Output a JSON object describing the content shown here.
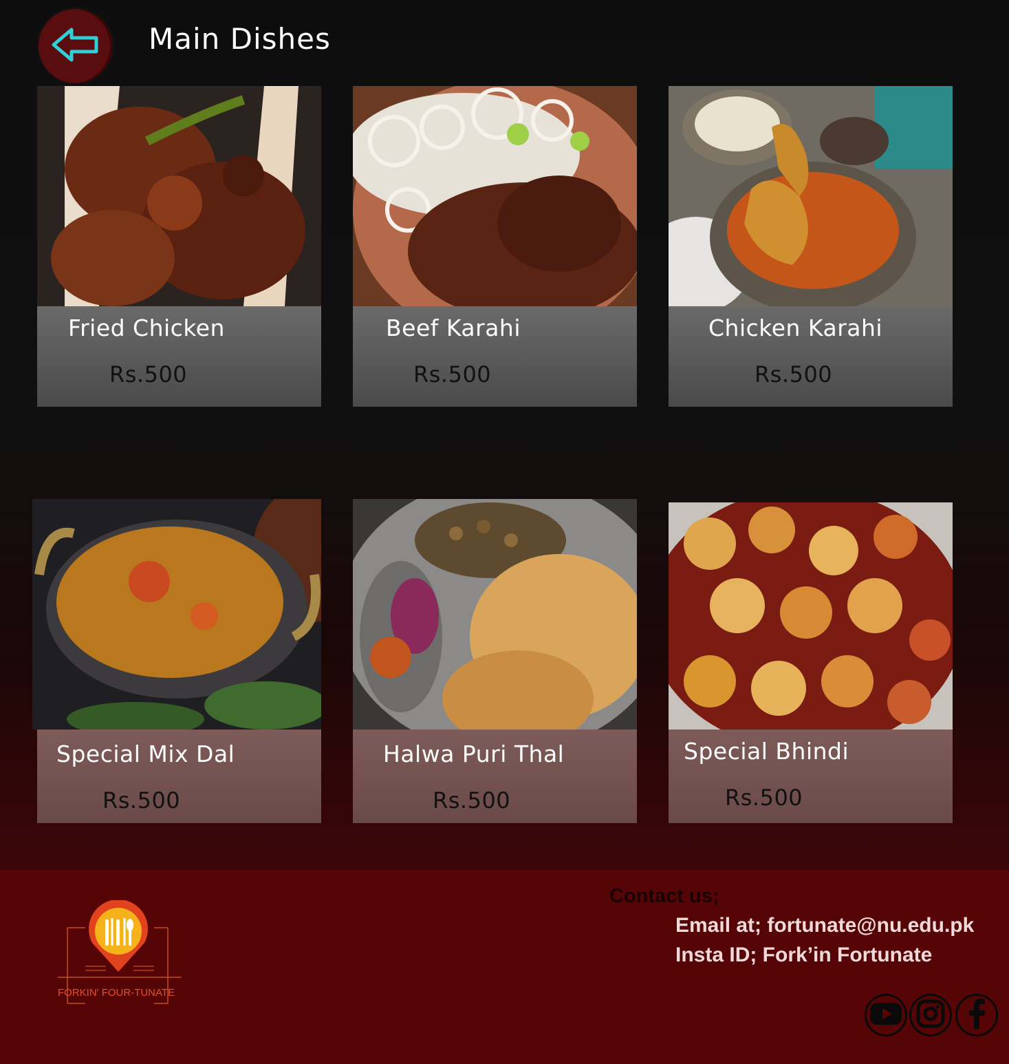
{
  "header": {
    "title": "Main Dishes"
  },
  "dishes": [
    {
      "name": "Fried Chicken",
      "price": "Rs.500"
    },
    {
      "name": "Beef Karahi",
      "price": "Rs.500"
    },
    {
      "name": "Chicken Karahi",
      "price": "Rs.500"
    },
    {
      "name": "Special Mix Dal",
      "price": "Rs.500"
    },
    {
      "name": "Halwa Puri Thal",
      "price": "Rs.500"
    },
    {
      "name": "Special Bhindi",
      "price": "Rs.500"
    }
  ],
  "footer": {
    "contact_heading": "Contact us;",
    "email_line": "Email at; fortunate@nu.edu.pk",
    "insta_line": "Insta ID; Fork’in Fortunate",
    "logo_text": "FORKIN' FOUR-TUNATE"
  },
  "icons": {
    "back": "back-arrow-icon",
    "youtube": "youtube-icon",
    "instagram": "instagram-icon",
    "facebook": "facebook-icon"
  },
  "colors": {
    "accent_cyan": "#2fd0d6",
    "back_button": "#5a0d0e",
    "footer_bg": "#560507"
  }
}
